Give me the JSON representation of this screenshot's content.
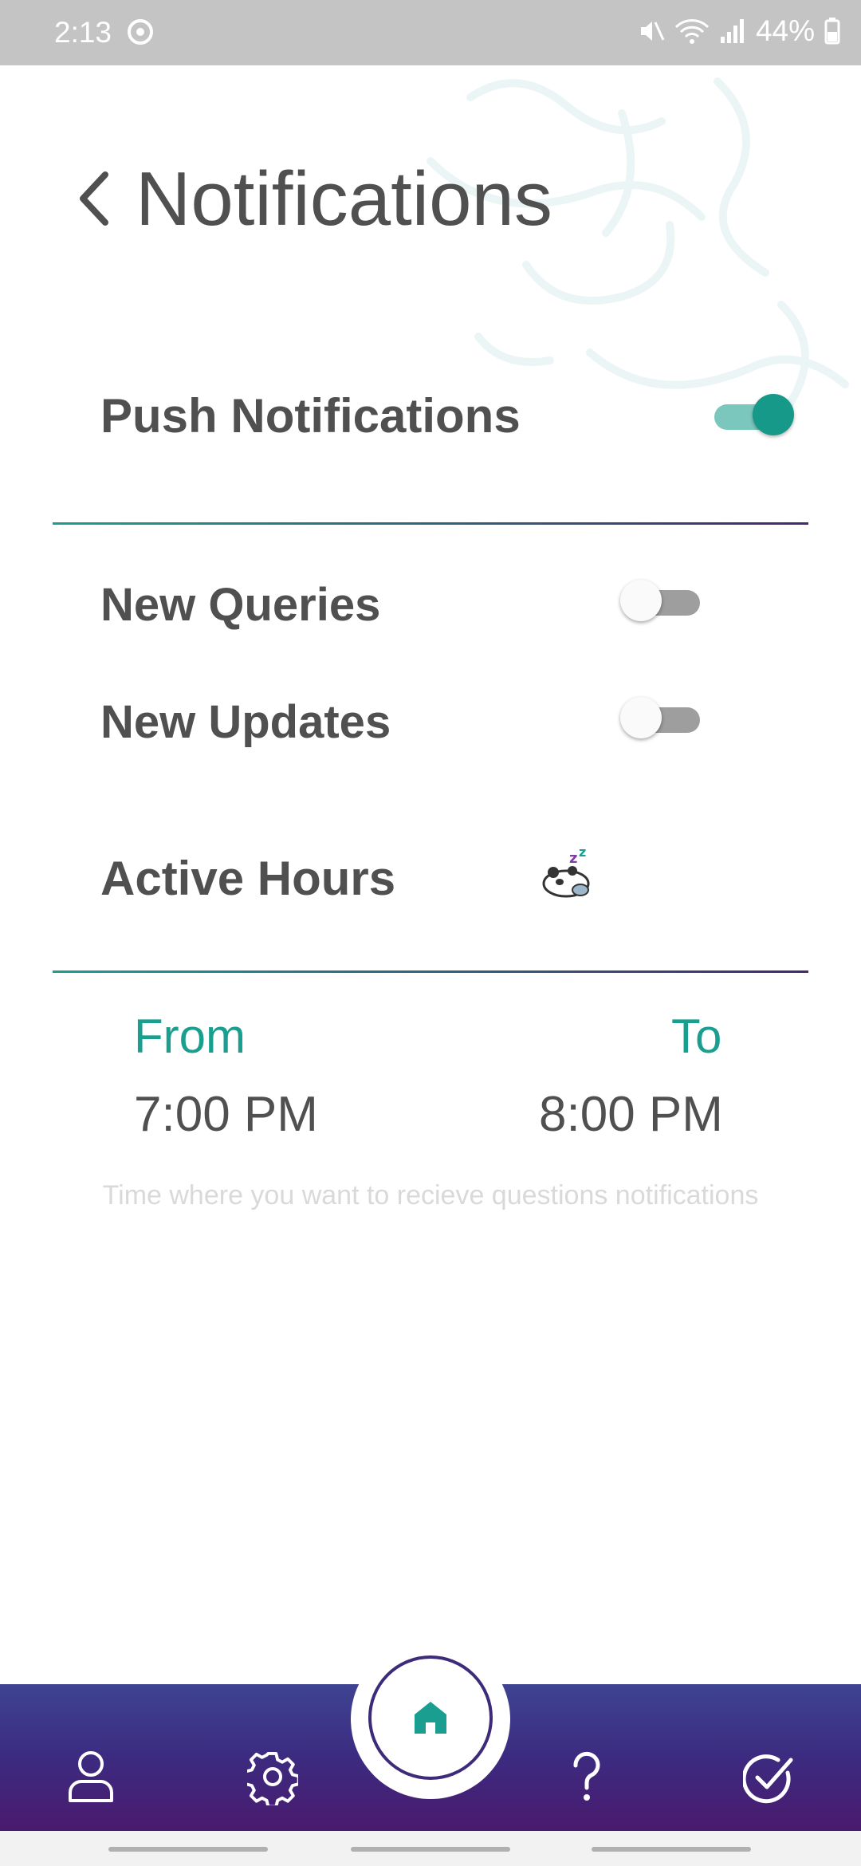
{
  "status_bar": {
    "time": "2:13",
    "battery": "44%"
  },
  "header": {
    "title": "Notifications"
  },
  "settings": {
    "push_notifications": {
      "label": "Push Notifications",
      "enabled": true
    },
    "new_queries": {
      "label": "New Queries",
      "enabled": false
    },
    "new_updates": {
      "label": "New Updates",
      "enabled": false
    },
    "active_hours": {
      "label": "Active Hours",
      "icon": "sleeping-panda-icon"
    }
  },
  "active_hours": {
    "from_label": "From",
    "from_value": "7:00 PM",
    "to_label": "To",
    "to_value": "8:00 PM",
    "hint": "Time where you want to recieve questions notifications"
  },
  "nav": {
    "items": [
      "profile-icon",
      "settings-gear-icon",
      "home-icon",
      "help-icon",
      "check-icon"
    ]
  },
  "colors": {
    "accent": "#1a9e8f",
    "nav_purple": "#3c2b80",
    "text": "#505050"
  }
}
